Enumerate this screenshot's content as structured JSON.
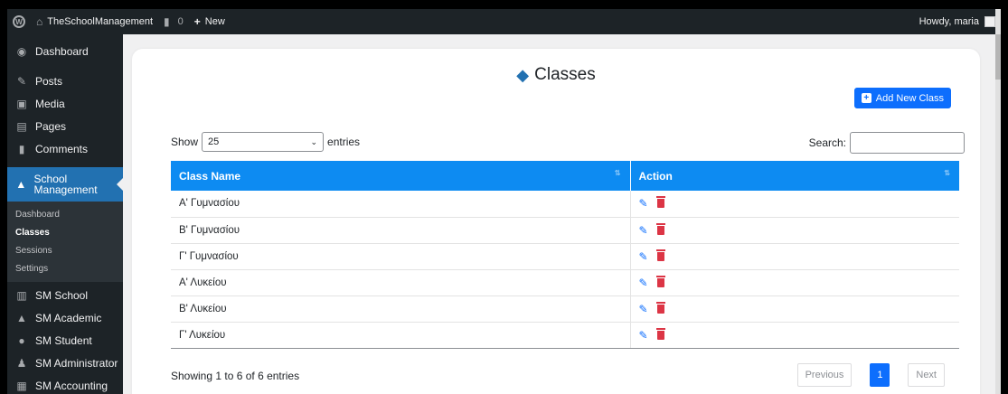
{
  "adminbar": {
    "site_name": "TheSchoolManagement",
    "comments_count": "0",
    "new_label": "New",
    "howdy": "Howdy, maria"
  },
  "sidebar": {
    "items": [
      {
        "label": "Dashboard",
        "icon": "dashboard-icon"
      },
      {
        "label": "Posts",
        "icon": "pin-icon"
      },
      {
        "label": "Media",
        "icon": "media-icon"
      },
      {
        "label": "Pages",
        "icon": "pages-icon"
      },
      {
        "label": "Comments",
        "icon": "comments-icon"
      },
      {
        "label": "School Management",
        "icon": "graduation-cap-icon"
      },
      {
        "label": "SM School",
        "icon": "building-icon"
      },
      {
        "label": "SM Academic",
        "icon": "graduation-cap-icon"
      },
      {
        "label": "SM Student",
        "icon": "users-icon"
      },
      {
        "label": "SM Administrator",
        "icon": "admin-icon"
      },
      {
        "label": "SM Accounting",
        "icon": "document-icon"
      }
    ],
    "submenu": [
      "Dashboard",
      "Classes",
      "Sessions",
      "Settings"
    ],
    "active_submenu": "Classes"
  },
  "main": {
    "title": "Classes",
    "add_button": "Add New Class",
    "show_label": "Show",
    "entries_value": "25",
    "entries_label": "entries",
    "search_label": "Search:",
    "columns": [
      "Class Name",
      "Action"
    ],
    "rows": [
      "Α' Γυμνασίου",
      "Β' Γυμνασίου",
      "Γ' Γυμνασίου",
      "Α' Λυκείου",
      "Β' Λυκείου",
      "Γ' Λυκείου"
    ],
    "info": "Showing 1 to 6 of 6 entries",
    "pagination": {
      "previous": "Previous",
      "page": "1",
      "next": "Next"
    }
  },
  "colors": {
    "accent": "#2271b1",
    "table_header": "#0d8bf2",
    "primary": "#0d6efd",
    "danger": "#dc3545"
  }
}
